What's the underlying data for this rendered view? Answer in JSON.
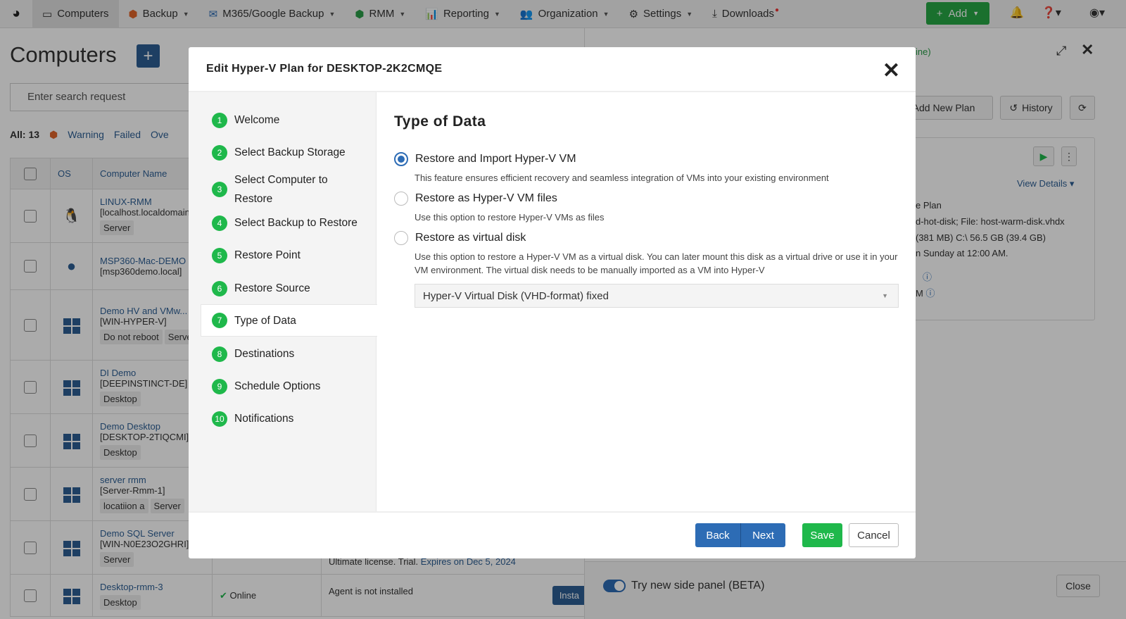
{
  "nav": {
    "items": [
      {
        "label": "Computers"
      },
      {
        "label": "Backup"
      },
      {
        "label": "M365/Google Backup"
      },
      {
        "label": "RMM"
      },
      {
        "label": "Reporting"
      },
      {
        "label": "Organization"
      },
      {
        "label": "Settings"
      },
      {
        "label": "Downloads"
      }
    ],
    "add_label": "Add"
  },
  "page": {
    "title": "Computers",
    "search_placeholder": "Enter search request",
    "all_count": "All: 13",
    "filters": [
      "Warning",
      "Failed",
      "Ove"
    ]
  },
  "table": {
    "headers": [
      "OS",
      "Computer Name"
    ],
    "rows": [
      {
        "os": "linux",
        "name": "LINUX-RMM",
        "host": "[localhost.localdomain]",
        "tags": [
          "Server"
        ]
      },
      {
        "os": "apple",
        "name": "MSP360-Mac-DEMO",
        "host": "[msp360demo.local]",
        "tags": []
      },
      {
        "os": "windows",
        "name": "Demo HV and VMw...",
        "host": "[WIN-HYPER-V]",
        "tags": [
          "Do not reboot",
          "Server"
        ]
      },
      {
        "os": "windows",
        "name": "DI Demo",
        "host": "[DEEPINSTINCT-DE]",
        "tags": [
          "Desktop"
        ]
      },
      {
        "os": "windows",
        "name": "Demo Desktop",
        "host": "[DESKTOP-2TIQCMI]",
        "tags": [
          "Desktop"
        ]
      },
      {
        "os": "windows",
        "name": "server rmm",
        "host": "[Server-Rmm-1]",
        "tags": [
          "locatiion a",
          "Server"
        ]
      },
      {
        "os": "windows",
        "name": "Demo SQL Server",
        "host": "[WIN-N0E23O2GHRI]",
        "tags": [
          "Server"
        ]
      },
      {
        "os": "windows",
        "name": "Desktop-rmm-3",
        "host": "",
        "tags": [
          "Desktop"
        ],
        "status": "Online",
        "agent": "Agent is not installed",
        "install": "Insta"
      }
    ],
    "license": "Ultimate license. Trial.",
    "expires": "Expires on Dec 5, 2024"
  },
  "side": {
    "status": "ine)",
    "add_plan": "Add New Plan",
    "history": "History",
    "view_details": "View Details",
    "lines": [
      "e Plan",
      "d-hot-disk; File: host-warm-disk.vhdx",
      "(381 MB) C:\\ 56.5 GB (39.4 GB)",
      "n Sunday at 12:00 AM."
    ],
    "line_m": "M",
    "beta": "Try new side panel (BETA)",
    "close": "Close"
  },
  "modal": {
    "title": "Edit Hyper-V Plan for DESKTOP-2K2CMQE",
    "steps": [
      {
        "n": "1",
        "label": "Welcome"
      },
      {
        "n": "2",
        "label": "Select Backup Storage"
      },
      {
        "n": "3",
        "label": "Select Computer to Restore"
      },
      {
        "n": "4",
        "label": "Select Backup to Restore"
      },
      {
        "n": "5",
        "label": "Restore Point"
      },
      {
        "n": "6",
        "label": "Restore Source"
      },
      {
        "n": "7",
        "label": "Type of Data"
      },
      {
        "n": "8",
        "label": "Destinations"
      },
      {
        "n": "9",
        "label": "Schedule  Options"
      },
      {
        "n": "10",
        "label": "Notifications"
      }
    ],
    "active_step": "7",
    "section_title": "Type of Data",
    "options": [
      {
        "label": "Restore and Import Hyper-V VM",
        "desc": "This feature ensures efficient recovery and seamless integration of VMs into your existing environment",
        "selected": true
      },
      {
        "label": "Restore as Hyper-V VM files",
        "desc": "Use this option to restore Hyper-V VMs as files",
        "selected": false
      },
      {
        "label": "Restore as virtual disk",
        "desc": "Use this option to restore a Hyper-V VM as a virtual disk. You can later mount this disk as a virtual drive or use it in your VM environment. The virtual disk needs to be manually imported as a VM into Hyper-V",
        "selected": false
      }
    ],
    "disk_format": "Hyper-V Virtual Disk (VHD-format) fixed",
    "buttons": {
      "back": "Back",
      "next": "Next",
      "save": "Save",
      "cancel": "Cancel"
    }
  },
  "colors": {
    "primary": "#2d6cb5",
    "success": "#1fb84b",
    "nav_bg": "#f2f2f2"
  }
}
